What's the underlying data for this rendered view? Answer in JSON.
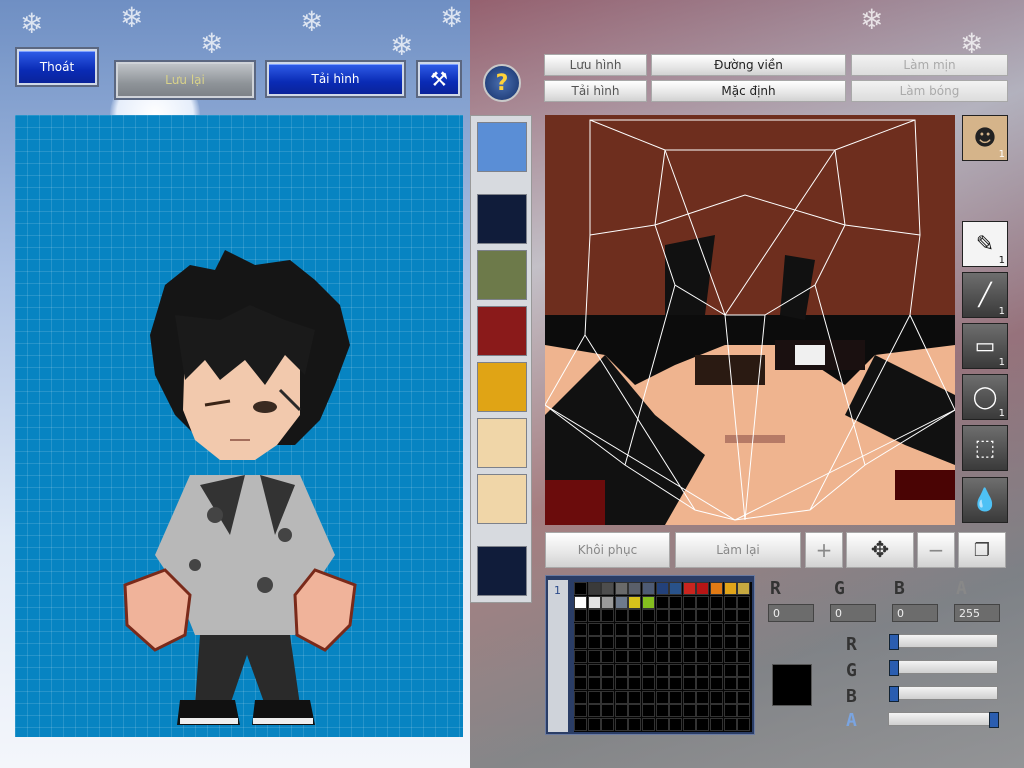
{
  "top_buttons": {
    "exit": "Thoát",
    "save": "Lưu lại",
    "load": "Tải hình"
  },
  "editor_toolbar": {
    "save_image": "Lưu hình",
    "load_image": "Tải hình",
    "outline": "Đường viền",
    "default": "Mặc định",
    "smooth": "Làm mịn",
    "shade": "Làm bóng"
  },
  "edit_controls": {
    "restore": "Khôi phục",
    "redo": "Làm lại"
  },
  "color": {
    "r_value": "0",
    "g_value": "0",
    "b_value": "0",
    "a_value": "255",
    "current": "#000000",
    "r_label": "R",
    "g_label": "G",
    "b_label": "B",
    "a_label": "A",
    "palette_index": "1",
    "sliders": {
      "r": 0,
      "g": 0,
      "b": 0,
      "a": 1.0
    }
  },
  "tool_badges": {
    "avatar": "1",
    "pen": "1",
    "line": "1",
    "rect": "1",
    "ellipse": "1"
  },
  "palette": [
    "#000000",
    "#3a3a3a",
    "#4d4d4d",
    "#6a6a6a",
    "#5a5f6a",
    "#4e5b74",
    "#23417a",
    "#29528a",
    "#c9251f",
    "#b71515",
    "#e07a15",
    "#e0a41a",
    "#c6a840",
    "#ffffff",
    "#e3e3e3",
    "#9a9a9a",
    "#6e7a8c",
    "#d8c21b",
    "#84bd1f",
    "#000000",
    "#000000",
    "#000000",
    "#000000",
    "#000000",
    "#000000",
    "#000000"
  ]
}
